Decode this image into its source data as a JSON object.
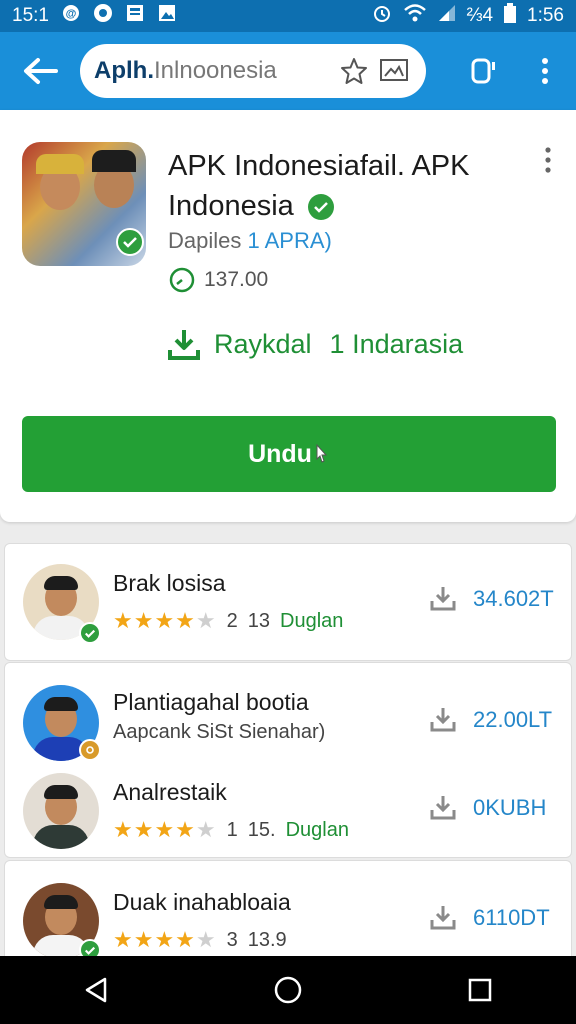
{
  "status_bar": {
    "time_left": "15:1",
    "signal_text": "⅔4",
    "clock": "1:56"
  },
  "app_bar": {
    "url_host": "Aplh.",
    "url_rest": "Inlnoonesia"
  },
  "app": {
    "title": "APK Indonesiafail. APK Indonesia",
    "developer_prefix": "Dapiles",
    "developer_accent": "1 APRA)",
    "size": "137.00",
    "download_label": "Raykdal",
    "download_extra": "1 Indarasia",
    "install_label": "Undu"
  },
  "list": [
    {
      "title": "Brak losisa",
      "rating": 4,
      "rating_text": "2",
      "count": "13",
      "tag": "Duglan",
      "size": "34.602T",
      "badge": "check"
    },
    {
      "title": "Plantiagahal bootia",
      "subtitle": "Aapcank SiSt Sienahar)",
      "size": "22.00LT",
      "badge": "gold"
    },
    {
      "title": "Analrestaik",
      "rating": 4,
      "rating_text": "1",
      "count": "15.",
      "tag": "Duglan",
      "size": "0KUBH",
      "badge": "none"
    },
    {
      "title": "Duak inahabloaia",
      "rating": 4,
      "rating_text": "3",
      "count": "13.9",
      "tag": "",
      "size": "6110DT",
      "badge": "check"
    }
  ],
  "colors": {
    "status_bar": "#0d6fb0",
    "app_bar": "#1a8fd9",
    "accent_green": "#23a035",
    "star": "#f2a516",
    "size_blue": "#2486c9"
  }
}
